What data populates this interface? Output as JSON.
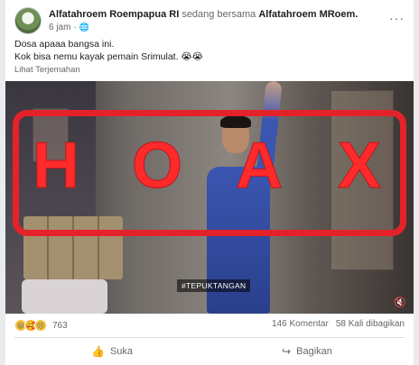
{
  "post": {
    "author": "Alfatahroem Roempapua RI",
    "with_text": "sedang bersama",
    "tagged": "Alfatahroem MRoem.",
    "time": "6 jam",
    "time_sep": "·",
    "globe_icon": "globe-icon",
    "more_label": "···",
    "text_line1": "Dosa apaaa bangsa ini.",
    "text_line2": "Kok bisa nemu kayak pemain Srimulat. 😭😭",
    "translate_label": "Lihat Terjemahan"
  },
  "media": {
    "hoax_letters": [
      "H",
      "O",
      "A",
      "X"
    ],
    "hashtag": "#TEPUKTANGAN",
    "volume_icon": "🔇"
  },
  "stats": {
    "reaction_icons": [
      "😆",
      "🥰",
      "😢"
    ],
    "reaction_count": "763",
    "comments": "146 Komentar",
    "shares": "58 Kali dibagikan"
  },
  "actions": {
    "like_label": "Suka",
    "share_label": "Bagikan",
    "like_icon": "👍",
    "share_icon": "↪"
  },
  "colors": {
    "hoax_red": "#e4222a",
    "meta_gray": "#65676b"
  }
}
